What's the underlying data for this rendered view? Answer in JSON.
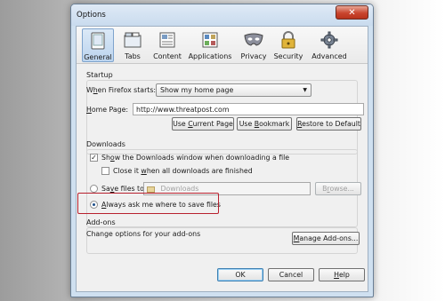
{
  "window": {
    "title": "Options",
    "close_symbol": "✕"
  },
  "tabs": [
    {
      "label": "General",
      "icon": "general-icon",
      "selected": true
    },
    {
      "label": "Tabs",
      "icon": "tabs-icon"
    },
    {
      "label": "Content",
      "icon": "content-icon"
    },
    {
      "label": "Applications",
      "icon": "applications-icon"
    },
    {
      "label": "Privacy",
      "icon": "privacy-mask-icon"
    },
    {
      "label": "Security",
      "icon": "security-lock-icon"
    },
    {
      "label": "Advanced",
      "icon": "advanced-gear-icon"
    }
  ],
  "startup": {
    "section_title": "Startup",
    "when_starts_label": "When Firefox starts:",
    "when_starts_value": "Show my home page",
    "home_page_label": "Home Page:",
    "home_page_value": "http://www.threatpost.com",
    "use_current_page": "Use Current Page",
    "use_bookmark": "Use Bookmark",
    "restore_default": "Restore to Default"
  },
  "downloads": {
    "section_title": "Downloads",
    "show_window_label": "Show the Downloads window when downloading a file",
    "show_window_checked": true,
    "close_it_label": "Close it when all downloads are finished",
    "close_it_checked": false,
    "save_files_label": "Save files to",
    "save_folder": "Downloads",
    "browse": "Browse...",
    "always_ask_label": "Always ask me where to save files",
    "always_ask_selected": true
  },
  "addons": {
    "section_title": "Add-ons",
    "description": "Change options for your add-ons",
    "manage_button": "Manage Add-ons..."
  },
  "footer": {
    "ok": "OK",
    "cancel": "Cancel",
    "help": "Help"
  },
  "colors": {
    "highlight": "#b8202e",
    "selected_tab": "#bcd4ee",
    "window_frame": "#cfe0f0"
  }
}
